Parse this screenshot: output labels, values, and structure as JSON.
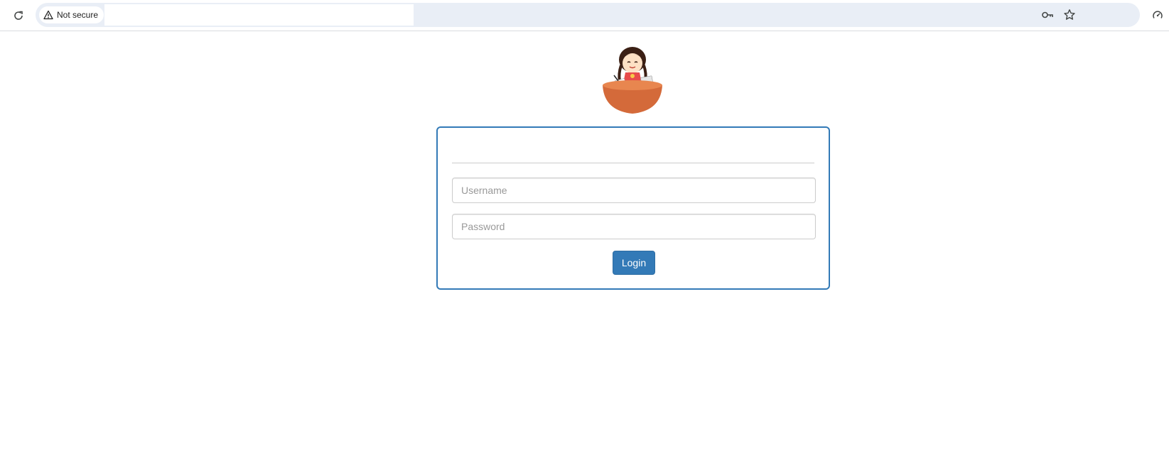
{
  "browser": {
    "security_label": "Not secure",
    "url": "",
    "icons": {
      "reload": "reload-icon",
      "warning": "warning-triangle-icon",
      "password_key": "key-icon",
      "bookmark": "star-icon",
      "performance": "gauge-icon"
    }
  },
  "login": {
    "heading": "",
    "username_placeholder": "Username",
    "password_placeholder": "Password",
    "submit_label": "Login"
  },
  "colors": {
    "primary": "#337ab7",
    "omnibox_bg": "#e9eef6"
  }
}
